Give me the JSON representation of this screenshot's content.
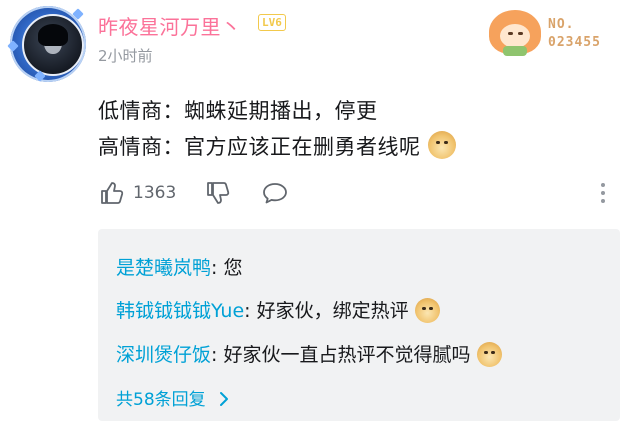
{
  "comment": {
    "username": "昨夜星河万里丶",
    "level": "LV6",
    "time": "2小时前",
    "fan_badge": {
      "label": "NO.",
      "number": "023455"
    },
    "lines": [
      "低情商：蜘蛛延期播出，停更",
      "高情商：官方应该正在删勇者线呢"
    ],
    "emoji": "doge",
    "likes": "1363"
  },
  "replies": [
    {
      "user": "是楚曦岚鸭",
      "sep": ": ",
      "text": "您"
    },
    {
      "user": "韩钺钺钺钺Yue",
      "sep": ": ",
      "text": "好家伙，绑定热评"
    },
    {
      "user": "深圳煲仔饭",
      "sep": ": ",
      "text": "好家伙一直占热评不觉得腻吗"
    }
  ],
  "more_replies": "共58条回复",
  "icons": {
    "like": "thumbs-up-icon",
    "dislike": "thumbs-down-icon",
    "reply": "speech-bubble-icon",
    "more": "vertical-ellipsis-icon",
    "chevron": "chevron-right-icon"
  },
  "colors": {
    "accent_pink": "#fb7299",
    "link_blue": "#00a1d6",
    "level_gold": "#f2c94c"
  }
}
